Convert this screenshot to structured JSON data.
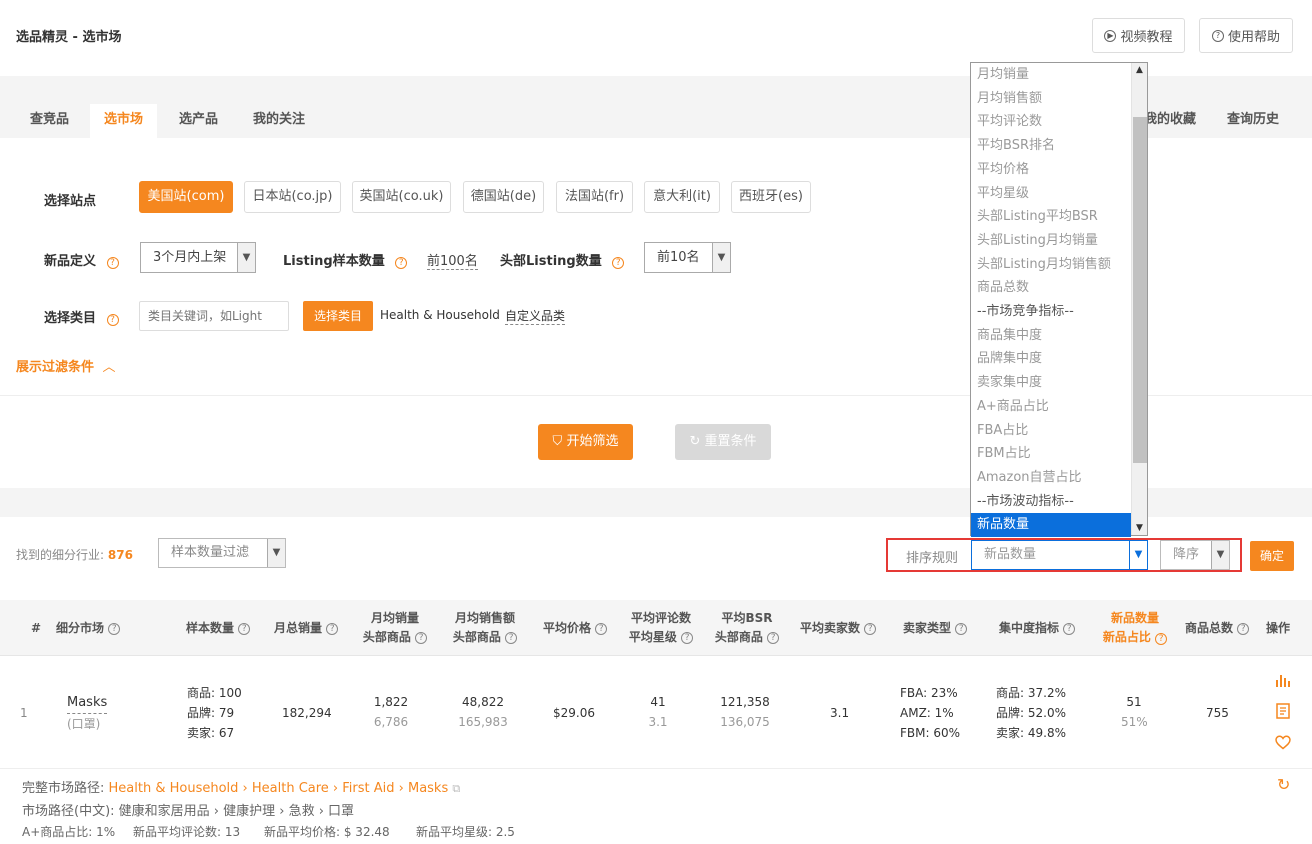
{
  "header": {
    "title": "选品精灵 - 选市场",
    "video_label": "视频教程",
    "help_label": "使用帮助"
  },
  "tabs": [
    "查竞品",
    "选市场",
    "选产品",
    "我的关注"
  ],
  "right_tabs": [
    "我的收藏",
    "查询历史"
  ],
  "filters": {
    "site_label": "选择站点",
    "sites": [
      "美国站(com)",
      "日本站(co.jp)",
      "英国站(co.uk)",
      "德国站(de)",
      "法国站(fr)",
      "意大利(it)",
      "西班牙(es)"
    ],
    "new_label": "新品定义",
    "new_value": "3个月内上架",
    "sample_label": "Listing样本数量",
    "sample_value": "前100名",
    "head_label": "头部Listing数量",
    "head_value": "前10名",
    "category_label": "选择类目",
    "category_placeholder": "类目关键词，如Light",
    "category_button": "选择类目",
    "category_selected": "Health & Household",
    "category_custom": "自定义品类",
    "toggle_label": "展示过滤条件",
    "start_label": "开始筛选",
    "reset_label": "重置条件"
  },
  "results": {
    "found_label": "找到的细分行业:",
    "found_count": "876",
    "sample_filter_placeholder": "样本数量过滤",
    "sort_label": "排序规则",
    "sort_value": "新品数量",
    "order_value": "降序",
    "confirm_label": "确定"
  },
  "table": {
    "headers": {
      "idx": "#",
      "market": "细分市场",
      "sample": "样本数量",
      "monthly_sales": "月总销量",
      "avg_sales_1": "月均销量",
      "avg_sales_2": "头部商品",
      "avg_rev_1": "月均销售额",
      "avg_rev_2": "头部商品",
      "avg_price": "平均价格",
      "reviews_1": "平均评论数",
      "reviews_2": "平均星级",
      "bsr_1": "平均BSR",
      "bsr_2": "头部商品",
      "sellers": "平均卖家数",
      "seller_type": "卖家类型",
      "concentration": "集中度指标",
      "new_1": "新品数量",
      "new_2": "新品占比",
      "total": "商品总数",
      "ops": "操作"
    },
    "row": {
      "idx": "1",
      "name": "Masks",
      "name_cn": "(口罩)",
      "sample_products": "商品: 100",
      "sample_brands": "品牌: 79",
      "sample_sellers": "卖家: 67",
      "monthly_sales": "182,294",
      "avg_sales": "1,822",
      "head_sales": "6,786",
      "avg_rev": "48,822",
      "head_rev": "165,983",
      "avg_price": "$29.06",
      "reviews": "41",
      "stars": "3.1",
      "bsr": "121,358",
      "head_bsr": "136,075",
      "sellers": "3.1",
      "fba": "FBA: 23%",
      "amz": "AMZ: 1%",
      "fbm": "FBM: 60%",
      "conc_products": "商品: 37.2%",
      "conc_brands": "品牌: 52.0%",
      "conc_sellers": "卖家: 49.8%",
      "new_count": "51",
      "new_ratio": "51%",
      "total": "755"
    },
    "details": {
      "path_label": "完整市场路径:",
      "path": "Health & Household › Health Care › First Aid › Masks",
      "path_cn": "市场路径(中文): 健康和家居用品 › 健康护理 › 急救 › 口罩",
      "aplus": "A+商品占比: 1%",
      "new_reviews": "新品平均评论数: 13",
      "new_price": "新品平均价格: $ 32.48",
      "new_stars": "新品平均星级: 2.5"
    }
  },
  "dropdown": {
    "options": [
      "月均销量",
      "月均销售额",
      "平均评论数",
      "平均BSR排名",
      "平均价格",
      "平均星级",
      "头部Listing平均BSR",
      "头部Listing月均销量",
      "头部Listing月均销售额",
      "商品总数",
      "--市场竞争指标--",
      "商品集中度",
      "品牌集中度",
      "卖家集中度",
      "A+商品占比",
      "FBA占比",
      "FBM占比",
      "Amazon自营占比",
      "--市场波动指标--",
      "新品数量"
    ],
    "selected": "新品数量"
  },
  "colors": {
    "accent": "#f5871f",
    "highlight": "#0b6fdc",
    "alert_border": "#e53935"
  }
}
